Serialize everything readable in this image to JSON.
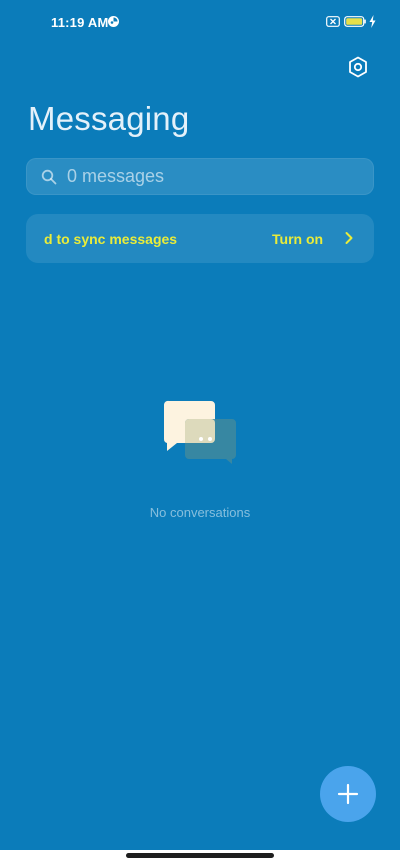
{
  "status_bar": {
    "time": "11:19 AM",
    "app_icon": "vpn-key-icon",
    "sim_icon": "no-sim-icon",
    "battery_icon": "battery-icon",
    "charging_icon": "charging-bolt-icon"
  },
  "header": {
    "title": "Messaging",
    "settings_icon": "settings-icon"
  },
  "search": {
    "placeholder": "0 messages",
    "icon": "search-icon"
  },
  "sync_banner": {
    "message": "d to sync messages",
    "action_label": "Turn on",
    "icon": "chevron-right-icon",
    "text_color": "#e9ec3a"
  },
  "empty_state": {
    "illustration": "chat-bubbles-icon",
    "text": "No conversations"
  },
  "fab": {
    "icon": "plus-icon",
    "color": "#4aa4ec"
  },
  "colors": {
    "background": "#0b7cba"
  }
}
